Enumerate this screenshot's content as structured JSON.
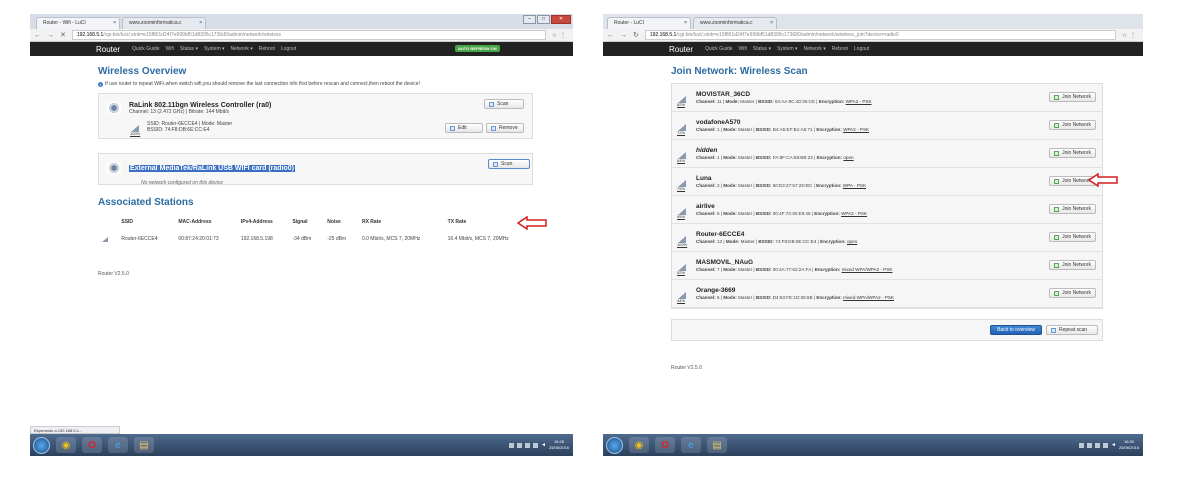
{
  "left": {
    "tabs": [
      "Router - Wifi - LuCI",
      "www.zoominformatica.c"
    ],
    "url_host": "192.168.5.1",
    "url_path": "/cgi-bin/luci/;stok=e15f801d24f7e999bf51d8395c1736d0/admin/network/wireless",
    "brand": "Router",
    "nav": [
      "Quick Guide",
      "Wifi",
      "Status ▾",
      "System ▾",
      "Network ▾",
      "Reboot",
      "Logout"
    ],
    "auto_refresh": "AUTO REFRESH ON",
    "title": "Wireless Overview",
    "hint": "If use router to repeat WiFi,when switch wifi,you should remove the last connection info first before rescan and connect,then reboot the device!",
    "dev1": {
      "name": "RaLink 802.11bgn Wireless Controller (ra0)",
      "sub": "Channel: 13 (2.472 GHz) | Bitrate: 144 Mbit/s",
      "scan": "Scan"
    },
    "net1": {
      "line1": "SSID: Router-6ECCE4 | Mode: Master",
      "line2": "BSSID: 74:F8:DB:6E:CC:E4",
      "pct": "100%",
      "edit": "Edit",
      "remove": "Remove"
    },
    "dev2": {
      "name": "External MediaTek/RaLink USB WIFI card (radio0)",
      "none": "No network configured on this device",
      "scan": "Scan"
    },
    "stations_title": "Associated Stations",
    "table_headers": [
      "SSID",
      "MAC-Address",
      "IPv4-Address",
      "Signal",
      "Noise",
      "RX Rate",
      "TX Rate"
    ],
    "table_row": [
      "Router-6ECCE4",
      "00:87:24:20:01:73",
      "192.168.5.198",
      "-34 dBm",
      "-25 dBm",
      "0.0 Mbit/s, MCS 7, 20MHz",
      "16.4 Mbit/s, MCS 7, 20MHz"
    ],
    "version": "Router V2.5.0",
    "status_text": "Esperando a 192.168.5.1...",
    "clock_time": "16:28",
    "clock_date": "25/06/2016"
  },
  "right": {
    "tabs": [
      "Router - LuCI",
      "www.zoominformatica.c"
    ],
    "url_host": "192.168.5.1",
    "url_path": "/cgi-bin/luci/;stok=e15f801d24f7e999bf51d8395c173680/admin/network/wireless_join?device=radio0",
    "brand": "Router",
    "nav": [
      "Quick Guide",
      "Wifi",
      "Status ▾",
      "System ▾",
      "Network ▾",
      "Reboot",
      "Logout"
    ],
    "title": "Join Network: Wireless Scan",
    "networks": [
      {
        "ssid": "MOVISTAR_36CD",
        "pct": "82%",
        "channel": "11",
        "mode": "Master",
        "bssid": "84:AA:9C:40:36:CE",
        "enc": "WPA2 - PSK",
        "italic": false
      },
      {
        "ssid": "vodafoneA570",
        "pct": "72%",
        "channel": "1",
        "mode": "Master",
        "bssid": "B4:A5:EF:B1:A5:71",
        "enc": "WPA2 - PSK",
        "italic": false
      },
      {
        "ssid": "hidden",
        "pct": "64%",
        "channel": "1",
        "mode": "Master",
        "bssid": "FA:8F:CA:88:BB:23",
        "enc": "open",
        "italic": true
      },
      {
        "ssid": "Luna",
        "pct": "75%",
        "channel": "2",
        "mode": "Master",
        "bssid": "60:E3:27:57:2D:BC",
        "enc": "WPA - PSK",
        "italic": false
      },
      {
        "ssid": "airlive",
        "pct": "95%",
        "channel": "6",
        "mode": "Master",
        "bssid": "00:4F:74:30:E8:48",
        "enc": "WPA2 - PSK",
        "italic": false
      },
      {
        "ssid": "Router-6ECCE4",
        "pct": "100%",
        "channel": "13",
        "mode": "Master",
        "bssid": "74:F8:DB:6E:CC:E4",
        "enc": "open",
        "italic": false
      },
      {
        "ssid": "MASMOVIL_NAuG",
        "pct": "52%",
        "channel": "7",
        "mode": "Master",
        "bssid": "00:4A:77:62:2A:FA",
        "enc": "mixed WPA/WPA2 - PSK",
        "italic": false
      },
      {
        "ssid": "Orange-3669",
        "pct": "44%",
        "channel": "6",
        "mode": "Master",
        "bssid": "D4:63:FE:1D:36:6B",
        "enc": "mixed WPA/WPA2 - PSK",
        "italic": false
      }
    ],
    "labels": {
      "channel": "Channel:",
      "mode": "Mode:",
      "bssid": "BSSID:",
      "enc": "Encryption:"
    },
    "join_label": "Join Network",
    "back": "Back to overview",
    "repeat": "Repeat scan",
    "version": "Router V2.5.0",
    "clock_time": "16:30",
    "clock_date": "25/06/2016"
  },
  "colors": {
    "accent": "#2d6ca2",
    "arrow": "#d32020",
    "navbar": "#222222"
  }
}
